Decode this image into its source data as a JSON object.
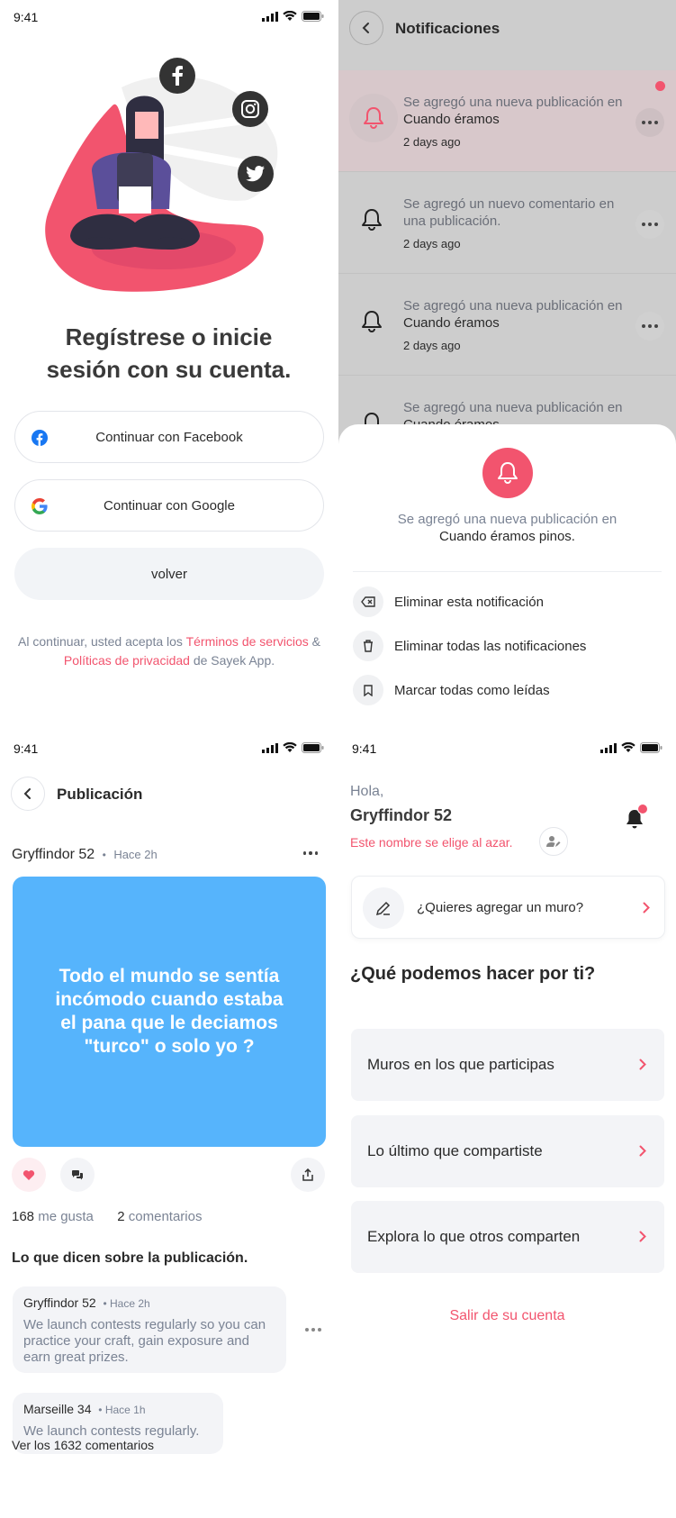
{
  "status": {
    "time": "9:41"
  },
  "login": {
    "title_line1": "Regístrese o inicie",
    "title_line2": "sesión con su cuenta.",
    "facebook_label": "Continuar con Facebook",
    "google_label": "Continuar con Google",
    "back_label": "volver",
    "terms_prefix": "Al continuar, usted acepta los",
    "terms_link": "Términos de servicios",
    "terms_and": "&",
    "privacy_link": "Políticas de privacidad",
    "terms_suffix": "de Sayek App."
  },
  "notifications": {
    "title": "Notificaciones",
    "items": [
      {
        "text_a": "Se agregó una nueva publicación en",
        "text_b": "Cuando éramos",
        "ago": "2 days ago",
        "unread": true
      },
      {
        "text_a": "Se agregó un nuevo comentario en una publicación.",
        "text_b": "",
        "ago": "2 days ago",
        "unread": false
      },
      {
        "text_a": "Se agregó una nueva publicación en",
        "text_b": "Cuando éramos",
        "ago": "2 days ago",
        "unread": false
      },
      {
        "text_a": "Se agregó una nueva publicación en",
        "text_b": "Cuando éramos",
        "ago": "",
        "unread": false
      }
    ],
    "sheet": {
      "message_a": "Se agregó una nueva publicación en",
      "message_b": "Cuando éramos pinos.",
      "actions": [
        "Eliminar esta notificación",
        "Eliminar todas las notificaciones",
        "Marcar todas como leídas"
      ]
    }
  },
  "post": {
    "title": "Publicación",
    "author": "Gryffindor 52",
    "time": "Hace 2h",
    "content": "Todo el mundo se sentía incómodo cuando estaba el pana que le deciamos \"turco\" o solo yo ?",
    "likes_count": "168",
    "likes_label": "me gusta",
    "comments_count": "2",
    "comments_label": "comentarios",
    "section_title": "Lo que dicen sobre la publicación.",
    "comments": [
      {
        "author": "Gryffindor 52",
        "time": "Hace 2h",
        "text": "We launch contests regularly so you can practice your craft, gain exposure and earn great prizes."
      },
      {
        "author": "Marseille 34",
        "time": "Hace 1h",
        "text": "We launch contests regularly."
      }
    ],
    "view_all": "Ver los 1632 comentarios",
    "colors": {
      "card": "#56b4fc",
      "accent": "#f2546e"
    }
  },
  "home": {
    "greeting": "Hola,",
    "username": "Gryffindor 52",
    "random_note": "Este nombre se elige al azar.",
    "add_wall": "¿Quieres agregar un muro?",
    "section_title": "¿Qué podemos hacer por ti?",
    "options": [
      "Muros en los que participas",
      "Lo último que compartiste",
      "Explora lo que otros comparten"
    ],
    "logout": "Salir de su cuenta"
  }
}
